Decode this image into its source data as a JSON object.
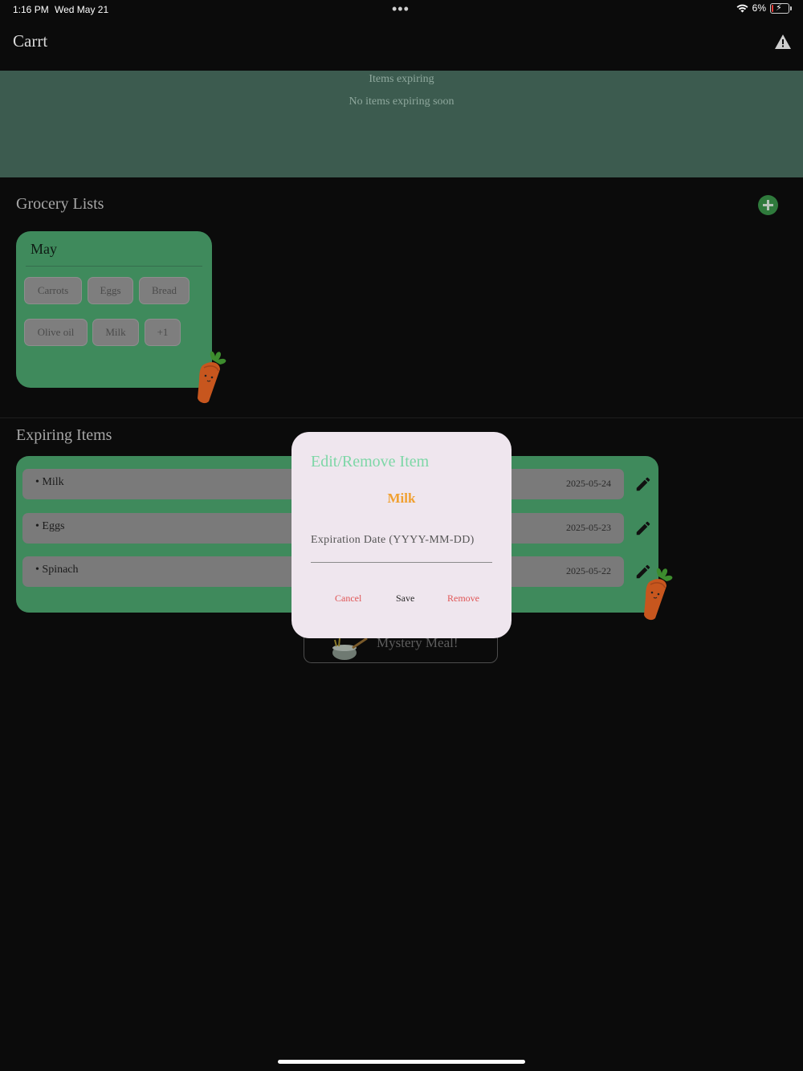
{
  "status_bar": {
    "time": "1:16 PM",
    "date": "Wed May 21",
    "dots": "•••",
    "battery_percent": "6%"
  },
  "header": {
    "title": "Carrt",
    "alert_icon": "warning-triangle-icon"
  },
  "expiring_banner": {
    "title": "Items expiring",
    "subtitle": "No items expiring soon"
  },
  "grocery_lists": {
    "title": "Grocery Lists",
    "lists": [
      {
        "name": "May",
        "items": [
          "Carrots",
          "Eggs",
          "Bread",
          "Olive oil",
          "Milk",
          "+1"
        ]
      }
    ]
  },
  "expiring_items": {
    "title": "Expiring Items",
    "items": [
      {
        "name": "• Milk",
        "date": "2025-05-24"
      },
      {
        "name": "• Eggs",
        "date": "2025-05-23"
      },
      {
        "name": "• Spinach",
        "date": "2025-05-22"
      }
    ]
  },
  "mystery_meal": {
    "label": "Mystery Meal!"
  },
  "modal": {
    "title": "Edit/Remove Item",
    "item_name": "Milk",
    "field_label": "Expiration Date (YYYY-MM-DD)",
    "cancel_label": "Cancel",
    "save_label": "Save",
    "remove_label": "Remove"
  },
  "colors": {
    "accent_green": "#3f8a5c",
    "banner_green": "#3c5b4f",
    "modal_bg": "#efe6ee",
    "title_mint": "#7ed7a7",
    "item_orange": "#f0a030",
    "danger_red": "#e05555"
  }
}
